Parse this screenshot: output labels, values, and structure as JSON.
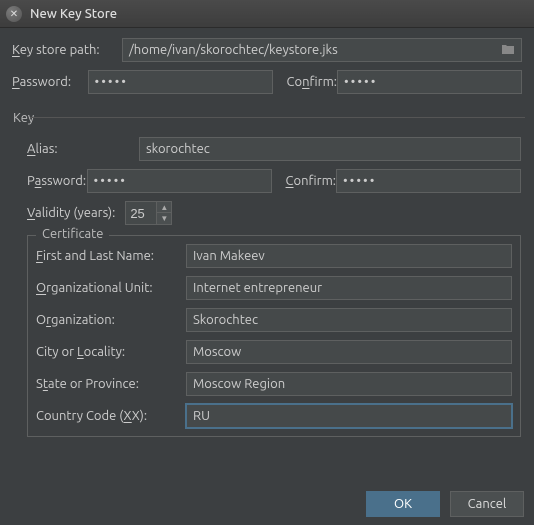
{
  "window": {
    "title": "New Key Store"
  },
  "form": {
    "keystore_path_label": "Key store path:",
    "keystore_path_value": "/home/ivan/skorochtec/keystore.jks",
    "password_label": "Password:",
    "password_value": "•••••",
    "confirm_label": "Confirm:",
    "confirm_value": "•••••"
  },
  "key": {
    "section_label": "Key",
    "alias_label": "Alias:",
    "alias_value": "skorochtec",
    "password_label": "Password:",
    "password_value": "•••••",
    "confirm_label": "Confirm:",
    "confirm_value": "•••••",
    "validity_label": "Validity (years):",
    "validity_value": "25"
  },
  "cert": {
    "legend": "Certificate",
    "first_last_label": "First and Last Name:",
    "first_last_value": "Ivan Makeev",
    "org_unit_label": "Organizational Unit:",
    "org_unit_value": "Internet entrepreneur",
    "org_label": "Organization:",
    "org_value": "Skorochtec",
    "city_label": "City or Locality:",
    "city_value": "Moscow",
    "state_label": "State or Province:",
    "state_value": "Moscow Region",
    "country_label": "Country Code (XX):",
    "country_value": "RU"
  },
  "buttons": {
    "ok": "OK",
    "cancel": "Cancel"
  }
}
